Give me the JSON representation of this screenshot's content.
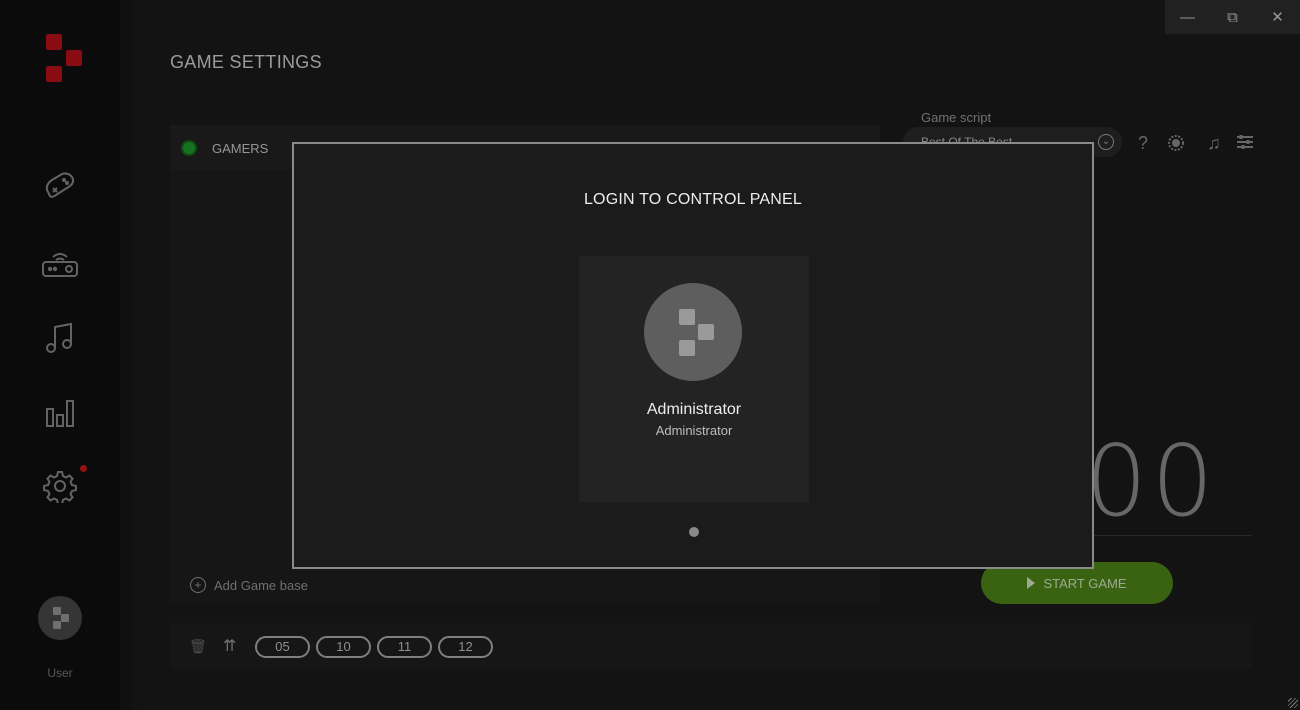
{
  "window": {
    "minimize_icon": "minimize-icon",
    "maximize_icon": "maximize-icon",
    "close_icon": "close-icon",
    "minimize_glyph": "—",
    "maximize_glyph": "⧉",
    "close_glyph": "✕"
  },
  "sidebar": {
    "logo_icon": "brand-logo",
    "items": [
      {
        "name": "games",
        "icon": "gamepad-icon"
      },
      {
        "name": "devices",
        "icon": "router-icon"
      },
      {
        "name": "music",
        "icon": "music-icon"
      },
      {
        "name": "stats",
        "icon": "bar-chart-icon"
      },
      {
        "name": "settings",
        "icon": "gear-icon",
        "notification": true
      }
    ],
    "user_label": "User"
  },
  "page": {
    "title": "GAME SETTINGS"
  },
  "gamers": {
    "label": "GAMERS",
    "status_color": "#1f9f2a",
    "add_base_label": "Add Game base"
  },
  "script": {
    "label": "Game script",
    "selected": "Best Of The Best"
  },
  "toolbar_icons": [
    "help-icon",
    "timer-icon",
    "music-note-icon",
    "equalizer-icon"
  ],
  "timer_display": "00",
  "start_button": {
    "label": "START GAME",
    "color": "#4f8a18"
  },
  "bottom_bar": {
    "pills": [
      "05",
      "10",
      "11",
      "12"
    ]
  },
  "modal": {
    "title": "LOGIN TO CONTROL PANEL",
    "account": {
      "name": "Administrator",
      "role": "Administrator"
    }
  },
  "accent_color": "#c0101a"
}
